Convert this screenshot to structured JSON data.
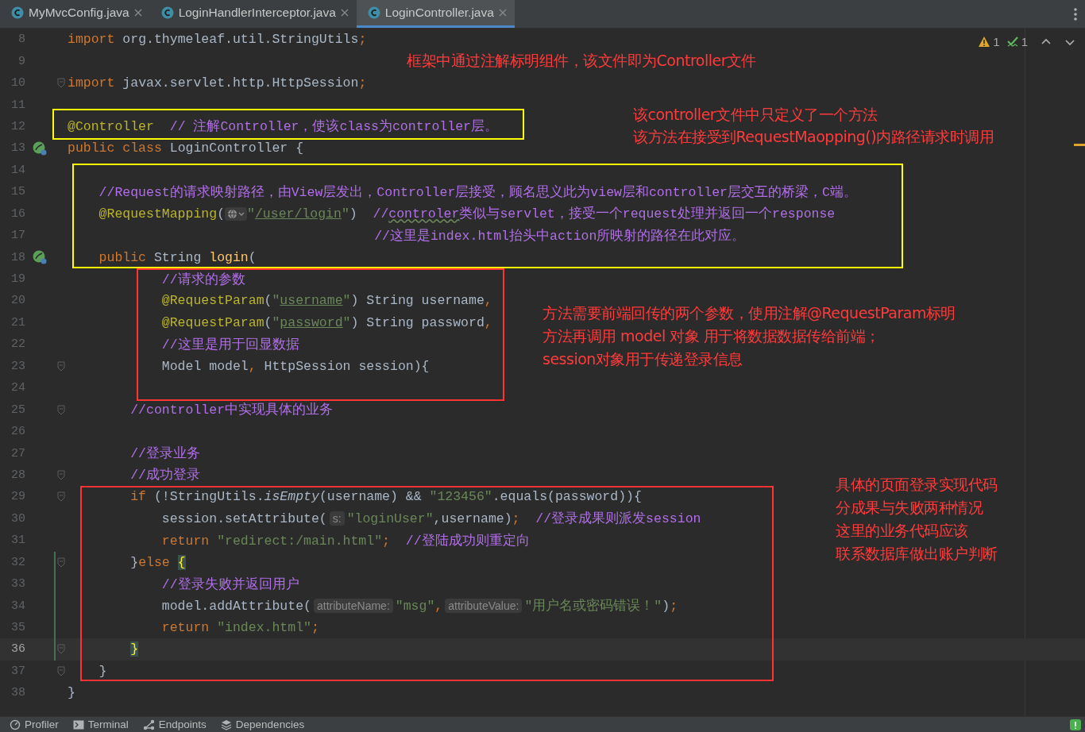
{
  "tabs": [
    {
      "label": "MyMvcConfig.java",
      "selected": false
    },
    {
      "label": "LoginHandlerInterceptor.java",
      "selected": false
    },
    {
      "label": "LoginController.java",
      "selected": true
    }
  ],
  "inspections": {
    "warnings": "1",
    "passed": "1"
  },
  "lines": [
    {
      "number": "8",
      "current": false,
      "fold": false,
      "changed": false,
      "bean": false,
      "parts": [
        {
          "kind": "keyword",
          "text": "import"
        },
        {
          "kind": "plain",
          "text": " org.thymeleaf.util.StringUtils"
        },
        {
          "kind": "punct",
          "text": ";"
        }
      ]
    },
    {
      "number": "9",
      "current": false,
      "fold": false,
      "changed": false,
      "bean": false
    },
    {
      "number": "10",
      "current": false,
      "fold": true,
      "changed": false,
      "bean": false,
      "parts": [
        {
          "kind": "keyword",
          "text": "import"
        },
        {
          "kind": "plain",
          "text": " javax.servlet.http.HttpSession"
        },
        {
          "kind": "punct",
          "text": ";"
        }
      ]
    },
    {
      "number": "11",
      "current": false,
      "fold": false,
      "changed": false,
      "bean": false
    },
    {
      "number": "12",
      "current": false,
      "fold": false,
      "changed": false,
      "bean": false,
      "parts": [
        {
          "kind": "annotation",
          "text": "@Controller"
        },
        {
          "kind": "comment",
          "text": "  // 注解Controller，使该class为controller层。"
        }
      ]
    },
    {
      "number": "13",
      "current": false,
      "fold": false,
      "changed": false,
      "bean": true,
      "parts": [
        {
          "kind": "keyword",
          "text": "public class"
        },
        {
          "kind": "plain",
          "text": " LoginController {"
        }
      ]
    },
    {
      "number": "14",
      "current": false,
      "fold": false,
      "changed": false,
      "bean": false
    },
    {
      "number": "15",
      "current": false,
      "fold": false,
      "changed": false,
      "bean": false,
      "parts": [
        {
          "kind": "comment",
          "text": "    //Request的请求映射路径，由View层发出，Controller层接受，顾名思义此为view层和controller层交互的桥梁，C端。"
        }
      ]
    },
    {
      "number": "16",
      "current": false,
      "fold": false,
      "changed": false,
      "bean": false,
      "parts": [
        {
          "kind": "annotation",
          "text": "    @RequestMapping"
        },
        {
          "kind": "plain",
          "text": "("
        },
        {
          "kind": "web-hint"
        },
        {
          "kind": "string",
          "text": "\""
        },
        {
          "kind": "link",
          "text": "/user/login"
        },
        {
          "kind": "string",
          "text": "\""
        },
        {
          "kind": "plain",
          "text": ")"
        },
        {
          "kind": "comment",
          "text": "  //"
        },
        {
          "kind": "typo",
          "text": "controler"
        },
        {
          "kind": "comment",
          "text": "类似与servlet，接受一个request处理并返回一个response"
        }
      ]
    },
    {
      "number": "17",
      "current": false,
      "fold": false,
      "changed": false,
      "bean": false,
      "parts": [
        {
          "kind": "comment",
          "text": "                                       //这里是index.html抬头中action所映射的路径在此对应。"
        }
      ]
    },
    {
      "number": "18",
      "current": false,
      "fold": false,
      "changed": false,
      "bean": true,
      "parts": [
        {
          "kind": "keyword",
          "text": "    public"
        },
        {
          "kind": "plain",
          "text": " String "
        },
        {
          "kind": "method",
          "text": "login"
        },
        {
          "kind": "plain",
          "text": "("
        }
      ]
    },
    {
      "number": "19",
      "current": false,
      "fold": false,
      "changed": false,
      "bean": false,
      "parts": [
        {
          "kind": "comment",
          "text": "            //请求的参数"
        }
      ]
    },
    {
      "number": "20",
      "current": false,
      "fold": false,
      "changed": false,
      "bean": false,
      "parts": [
        {
          "kind": "annotation",
          "text": "            @RequestParam"
        },
        {
          "kind": "plain",
          "text": "("
        },
        {
          "kind": "string",
          "text": "\""
        },
        {
          "kind": "link",
          "text": "username"
        },
        {
          "kind": "string",
          "text": "\""
        },
        {
          "kind": "plain",
          "text": ") String username"
        },
        {
          "kind": "punct",
          "text": ","
        }
      ]
    },
    {
      "number": "21",
      "current": false,
      "fold": false,
      "changed": false,
      "bean": false,
      "parts": [
        {
          "kind": "annotation",
          "text": "            @RequestParam"
        },
        {
          "kind": "plain",
          "text": "("
        },
        {
          "kind": "string",
          "text": "\""
        },
        {
          "kind": "link",
          "text": "password"
        },
        {
          "kind": "string",
          "text": "\""
        },
        {
          "kind": "plain",
          "text": ") String password"
        },
        {
          "kind": "punct",
          "text": ","
        }
      ]
    },
    {
      "number": "22",
      "current": false,
      "fold": false,
      "changed": false,
      "bean": false,
      "parts": [
        {
          "kind": "comment",
          "text": "            //这里是用于回显数据"
        }
      ]
    },
    {
      "number": "23",
      "current": false,
      "fold": true,
      "changed": false,
      "bean": false,
      "parts": [
        {
          "kind": "plain",
          "text": "            Model model"
        },
        {
          "kind": "punct",
          "text": ","
        },
        {
          "kind": "plain",
          "text": " HttpSession session){"
        }
      ]
    },
    {
      "number": "24",
      "current": false,
      "fold": false,
      "changed": false,
      "bean": false
    },
    {
      "number": "25",
      "current": false,
      "fold": true,
      "changed": false,
      "bean": false,
      "parts": [
        {
          "kind": "comment",
          "text": "        //controller中实现具体的业务"
        }
      ]
    },
    {
      "number": "26",
      "current": false,
      "fold": false,
      "changed": false,
      "bean": false
    },
    {
      "number": "27",
      "current": false,
      "fold": false,
      "changed": false,
      "bean": false,
      "parts": [
        {
          "kind": "comment",
          "text": "        //登录业务"
        }
      ]
    },
    {
      "number": "28",
      "current": false,
      "fold": true,
      "changed": false,
      "bean": false,
      "parts": [
        {
          "kind": "comment",
          "text": "        //成功登录"
        }
      ]
    },
    {
      "number": "29",
      "current": false,
      "fold": true,
      "changed": false,
      "bean": false,
      "parts": [
        {
          "kind": "keyword",
          "text": "        if"
        },
        {
          "kind": "plain",
          "text": " (!StringUtils."
        },
        {
          "kind": "static",
          "text": "isEmpty"
        },
        {
          "kind": "plain",
          "text": "(username) && "
        },
        {
          "kind": "string",
          "text": "\"123456\""
        },
        {
          "kind": "plain",
          "text": ".equals(password)){"
        }
      ]
    },
    {
      "number": "30",
      "current": false,
      "fold": false,
      "changed": false,
      "bean": false,
      "parts": [
        {
          "kind": "plain",
          "text": "            session.setAttribute("
        },
        {
          "kind": "hint",
          "text": "s:"
        },
        {
          "kind": "string",
          "text": "\"loginUser\""
        },
        {
          "kind": "plain",
          "text": ",username)"
        },
        {
          "kind": "punct",
          "text": ";"
        },
        {
          "kind": "comment",
          "text": "  //登录成果则派发session"
        }
      ]
    },
    {
      "number": "31",
      "current": false,
      "fold": false,
      "changed": false,
      "bean": false,
      "parts": [
        {
          "kind": "keyword",
          "text": "            return "
        },
        {
          "kind": "string",
          "text": "\"redirect:/main.html\""
        },
        {
          "kind": "punct",
          "text": ";"
        },
        {
          "kind": "comment",
          "text": "  //登陆成功则重定向"
        }
      ]
    },
    {
      "number": "32",
      "current": false,
      "fold": true,
      "changed": true,
      "bean": false,
      "parts": [
        {
          "kind": "plain",
          "text": "        }"
        },
        {
          "kind": "keyword",
          "text": "else "
        },
        {
          "kind": "brace",
          "text": "{"
        }
      ]
    },
    {
      "number": "33",
      "current": false,
      "fold": false,
      "changed": true,
      "bean": false,
      "parts": [
        {
          "kind": "comment",
          "text": "            //登录失败并返回用户"
        }
      ]
    },
    {
      "number": "34",
      "current": false,
      "fold": false,
      "changed": true,
      "bean": false,
      "parts": [
        {
          "kind": "plain",
          "text": "            model.addAttribute("
        },
        {
          "kind": "hint",
          "text": "attributeName:"
        },
        {
          "kind": "string",
          "text": "\"msg\""
        },
        {
          "kind": "punct",
          "text": ","
        },
        {
          "kind": "hint",
          "text": "attributeValue:"
        },
        {
          "kind": "string",
          "text": "\"用户名或密码错误！\""
        },
        {
          "kind": "plain",
          "text": ")"
        },
        {
          "kind": "punct",
          "text": ";"
        }
      ]
    },
    {
      "number": "35",
      "current": false,
      "fold": false,
      "changed": true,
      "bean": false,
      "parts": [
        {
          "kind": "keyword",
          "text": "            return "
        },
        {
          "kind": "string",
          "text": "\"index.html\""
        },
        {
          "kind": "punct",
          "text": ";"
        }
      ]
    },
    {
      "number": "36",
      "current": true,
      "fold": true,
      "changed": true,
      "bean": false,
      "parts": [
        {
          "kind": "brace",
          "text": "        }"
        }
      ]
    },
    {
      "number": "37",
      "current": false,
      "fold": true,
      "changed": false,
      "bean": false,
      "parts": [
        {
          "kind": "plain",
          "text": "    }"
        }
      ]
    },
    {
      "number": "38",
      "current": false,
      "fold": false,
      "changed": false,
      "bean": false,
      "parts": [
        {
          "kind": "plain",
          "text": "}"
        }
      ]
    }
  ],
  "boxes": [
    {
      "color": "#ffff00"
    },
    {
      "color": "#ffff00"
    },
    {
      "color": "#ff3333"
    },
    {
      "color": "#ff3333"
    }
  ],
  "notes": [
    {
      "lines": [
        "框架中通过注解标明组件，该文件即为Controller文件"
      ]
    },
    {
      "lines": [
        "该controller文件中只定义了一个方法",
        "该方法在接受到RequestMaopping()内路径请求时调用"
      ]
    },
    {
      "lines": [
        "方法需要前端回传的两个参数，使用注解@RequestParam标明",
        "方法再调用 model 对象 用于将数据数据传给前端；",
        "session对象用于传递登录信息"
      ]
    },
    {
      "lines": [
        "具体的页面登录实现代码",
        "分成果与失败两种情况",
        "这里的业务代码应该",
        "联系数据库做出账户判断"
      ]
    }
  ],
  "tool_windows": [
    "Profiler",
    "Terminal",
    "Endpoints",
    "Dependencies"
  ]
}
